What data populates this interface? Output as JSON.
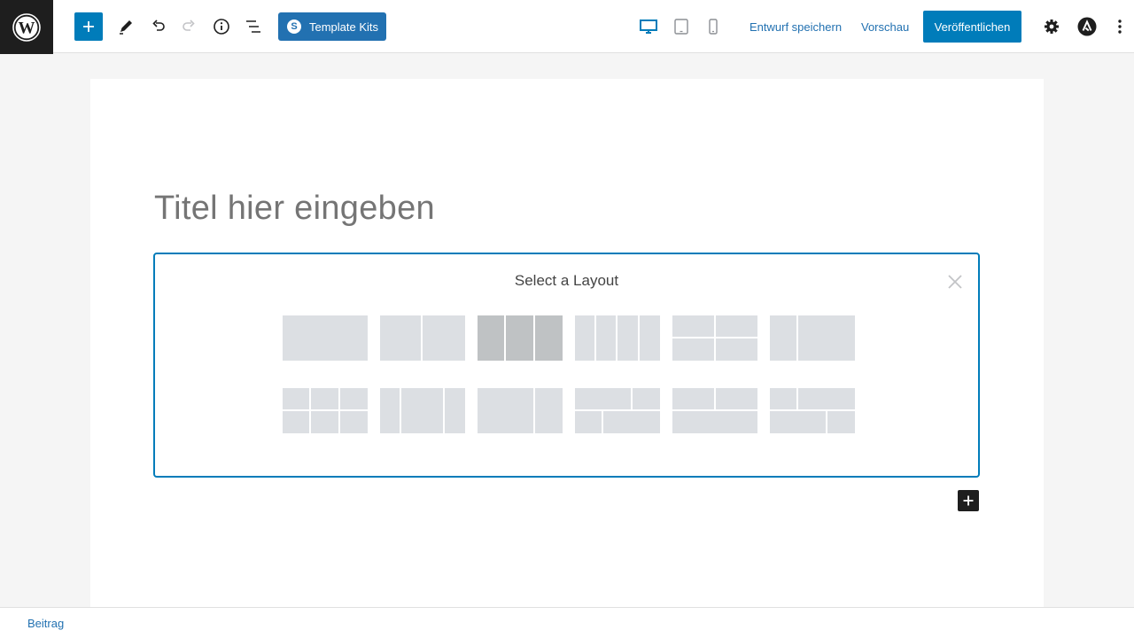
{
  "toolbar": {
    "template_kits_label": "Template Kits",
    "save_draft_label": "Entwurf speichern",
    "preview_label": "Vorschau",
    "publish_label": "Veröffentlichen",
    "icons": [
      "wordpress-logo-icon",
      "plus-icon",
      "pencil-icon",
      "undo-icon",
      "redo-icon",
      "info-icon",
      "list-view-icon",
      "desktop-icon",
      "tablet-icon",
      "mobile-icon",
      "gear-icon",
      "astra-icon"
    ],
    "accent_color": "#007cba"
  },
  "editor": {
    "title_placeholder": "Titel hier eingeben",
    "layout_picker": {
      "title": "Select a Layout",
      "selected_index": 2,
      "option_count": 12
    }
  },
  "footer": {
    "breadcrumb": "Beitrag"
  }
}
